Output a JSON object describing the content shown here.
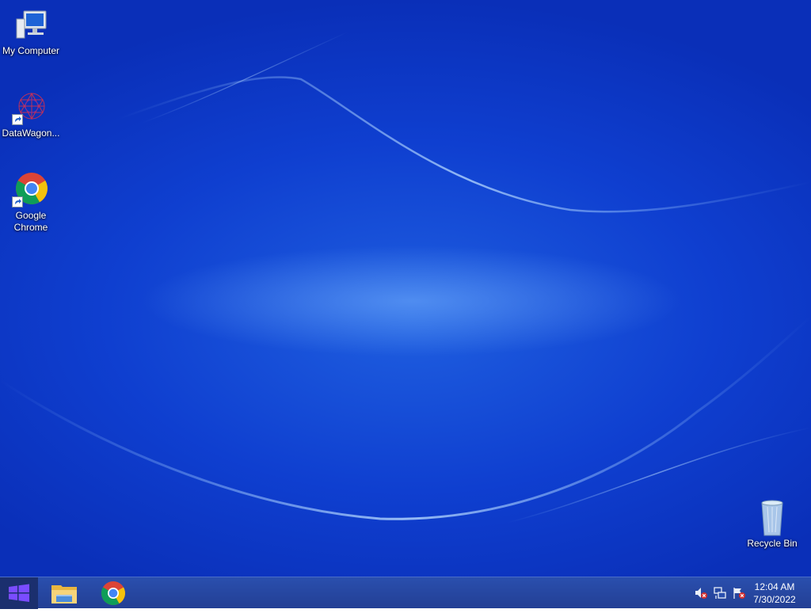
{
  "desktop": {
    "icons": [
      {
        "label": "My Computer",
        "icon": "computer-icon"
      },
      {
        "label": "DataWagon...",
        "icon": "datawagon-icon"
      },
      {
        "label": "Google Chrome",
        "icon": "chrome-icon"
      },
      {
        "label": "Recycle Bin",
        "icon": "recycle-bin-icon"
      }
    ]
  },
  "taskbar": {
    "start": {
      "icon": "windows-logo-icon"
    },
    "pinned": [
      {
        "icon": "file-explorer-icon"
      },
      {
        "icon": "chrome-icon"
      }
    ],
    "tray": {
      "icons": [
        "speaker-muted-icon",
        "network-icon",
        "action-center-flag-icon"
      ],
      "time": "12:04 AM",
      "date": "7/30/2022"
    }
  },
  "colors": {
    "wallpaper": "#1248d6",
    "taskbar": "#2a4fae",
    "start_button": "#1b2f6e",
    "windows_logo": "#7a4cff"
  }
}
